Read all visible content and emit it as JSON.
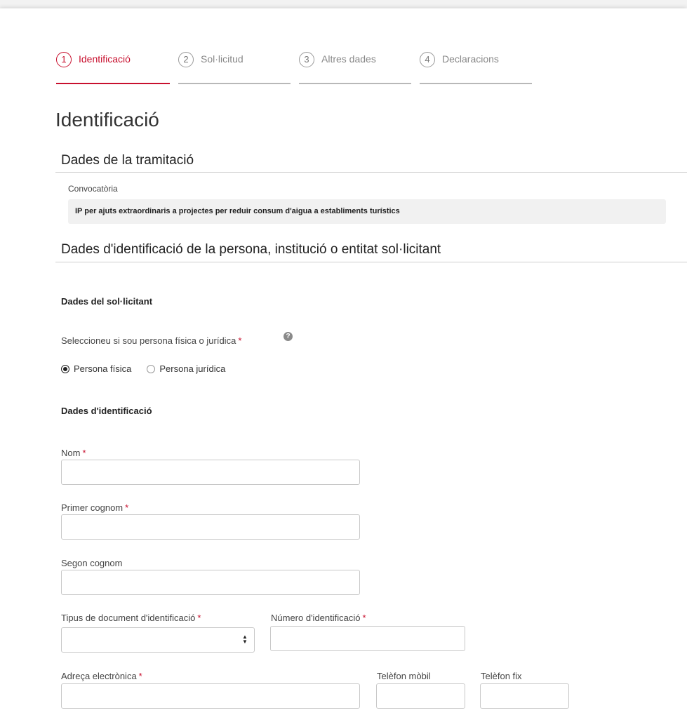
{
  "stepper": {
    "steps": [
      {
        "number": "1",
        "label": "Identificació",
        "active": true
      },
      {
        "number": "2",
        "label": "Sol·licitud",
        "active": false
      },
      {
        "number": "3",
        "label": "Altres dades",
        "active": false
      },
      {
        "number": "4",
        "label": "Declaracions",
        "active": false
      }
    ]
  },
  "page_title": "Identificació",
  "tramitacio": {
    "title": "Dades de la tramitació",
    "convocatoria_label": "Convocatòria",
    "convocatoria_value": "IP per ajuts extraordinaris a projectes per reduir consum d'aigua a establiments turístics"
  },
  "identificacio_section": {
    "title": "Dades d'identificació de la persona, institució o entitat sol·licitant"
  },
  "sollicitant": {
    "heading": "Dades del sol·licitant",
    "tipus_label": "Seleccioneu si sou persona física o jurídica",
    "required_mark": "*",
    "help_icon": "question-circle-icon",
    "help_glyph": "?",
    "options": [
      {
        "label": "Persona física",
        "checked": true
      },
      {
        "label": "Persona jurídica",
        "checked": false
      }
    ]
  },
  "dades_identificacio": {
    "heading": "Dades d'identificació",
    "nom_label": "Nom",
    "nom_value": "",
    "primer_cognom_label": "Primer cognom",
    "primer_cognom_value": "",
    "segon_cognom_label": "Segon cognom",
    "segon_cognom_value": "",
    "tipus_document_label": "Tipus de document d'identificació",
    "tipus_document_value": "",
    "numero_label": "Número d'identificació",
    "numero_value": "",
    "email_label": "Adreça electrònica",
    "email_value": "",
    "mobil_label": "Telèfon mòbil",
    "mobil_value": "",
    "fix_label": "Telèfon fix",
    "fix_value": ""
  },
  "colors": {
    "accent": "#c8102e",
    "inactive_step": "#888888",
    "readonly_bg": "#f1f1f1"
  }
}
